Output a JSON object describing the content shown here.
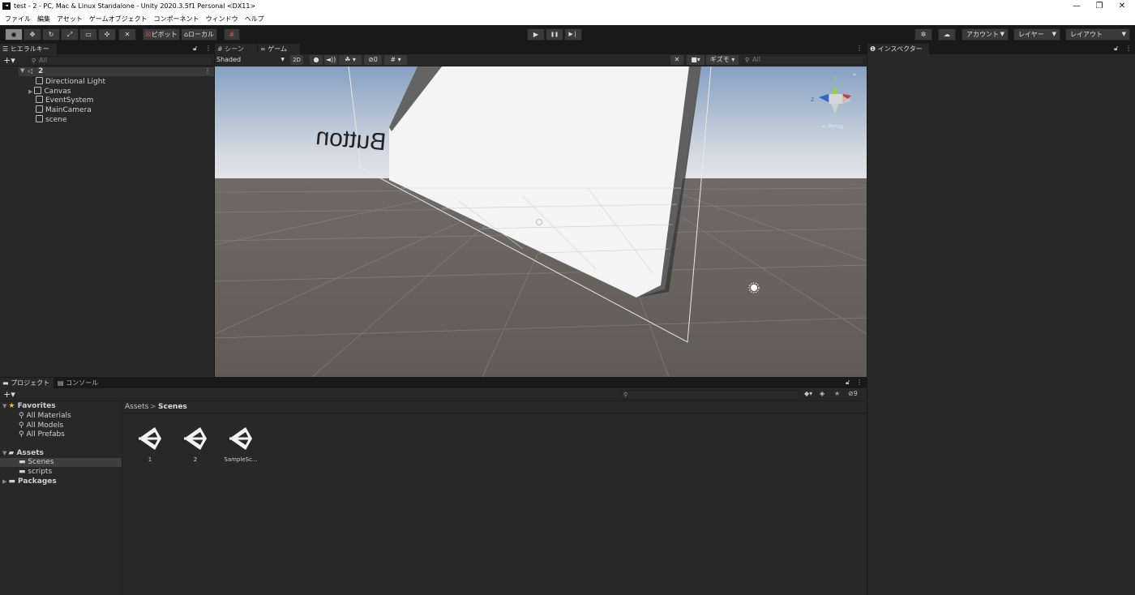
{
  "window": {
    "title": "test - 2 - PC, Mac & Linux Standalone - Unity 2020.3.5f1 Personal <DX11>",
    "app_icon": "unity-logo-icon",
    "controls": {
      "minimize": "—",
      "restore": "❐",
      "close": "✕"
    }
  },
  "menu": [
    "ファイル",
    "編集",
    "アセット",
    "ゲームオブジェクト",
    "コンポーネント",
    "ウィンドウ",
    "ヘルプ"
  ],
  "toolbar": {
    "pivot_label": "ピボット",
    "local_label": "ローカル",
    "play_icon": "▶",
    "pause_icon": "❚❚",
    "step_icon": "▶❘",
    "account_label": "アカウント",
    "layers_label": "レイヤー",
    "layout_label": "レイアウト"
  },
  "hierarchy": {
    "tab_label": "ヒエラルキー",
    "search_placeholder": "All",
    "scene_name": "2",
    "items": [
      {
        "label": "Directional Light",
        "has_children": false
      },
      {
        "label": "Canvas",
        "has_children": true
      },
      {
        "label": "EventSystem",
        "has_children": false
      },
      {
        "label": "MainCamera",
        "has_children": false
      },
      {
        "label": "scene",
        "has_children": false
      }
    ]
  },
  "scene_tabs": {
    "scene_label": "シーン",
    "game_label": "ゲーム"
  },
  "scene_toolbar": {
    "shading_mode": "Shaded",
    "mode_2d": "2D",
    "hidden_count": "0",
    "gizmos_label": "ギズモ",
    "search_placeholder": "All"
  },
  "scene": {
    "button_text": "Button",
    "orientation_label": "< Persp",
    "axis_x": "x",
    "axis_y": "y",
    "axis_z": "z"
  },
  "inspector": {
    "tab_label": "インスペクター"
  },
  "bottom_tabs": {
    "project_label": "プロジェクト",
    "console_label": "コンソール"
  },
  "project": {
    "hidden_count": "9",
    "favorites_label": "Favorites",
    "favorites": [
      "All Materials",
      "All Models",
      "All Prefabs"
    ],
    "assets_label": "Assets",
    "asset_folders": [
      "Scenes",
      "scripts"
    ],
    "packages_label": "Packages",
    "breadcrumb": {
      "root": "Assets",
      "separator": ">",
      "current": "Scenes"
    },
    "files": [
      "1",
      "2",
      "SampleSc..."
    ]
  },
  "colors": {
    "sky_top": "#86a0c2",
    "horizon": "#d5dbe1",
    "ground": "#6b6560",
    "panel_bg": "#282828",
    "selected_folder": "#3e3e3e"
  }
}
